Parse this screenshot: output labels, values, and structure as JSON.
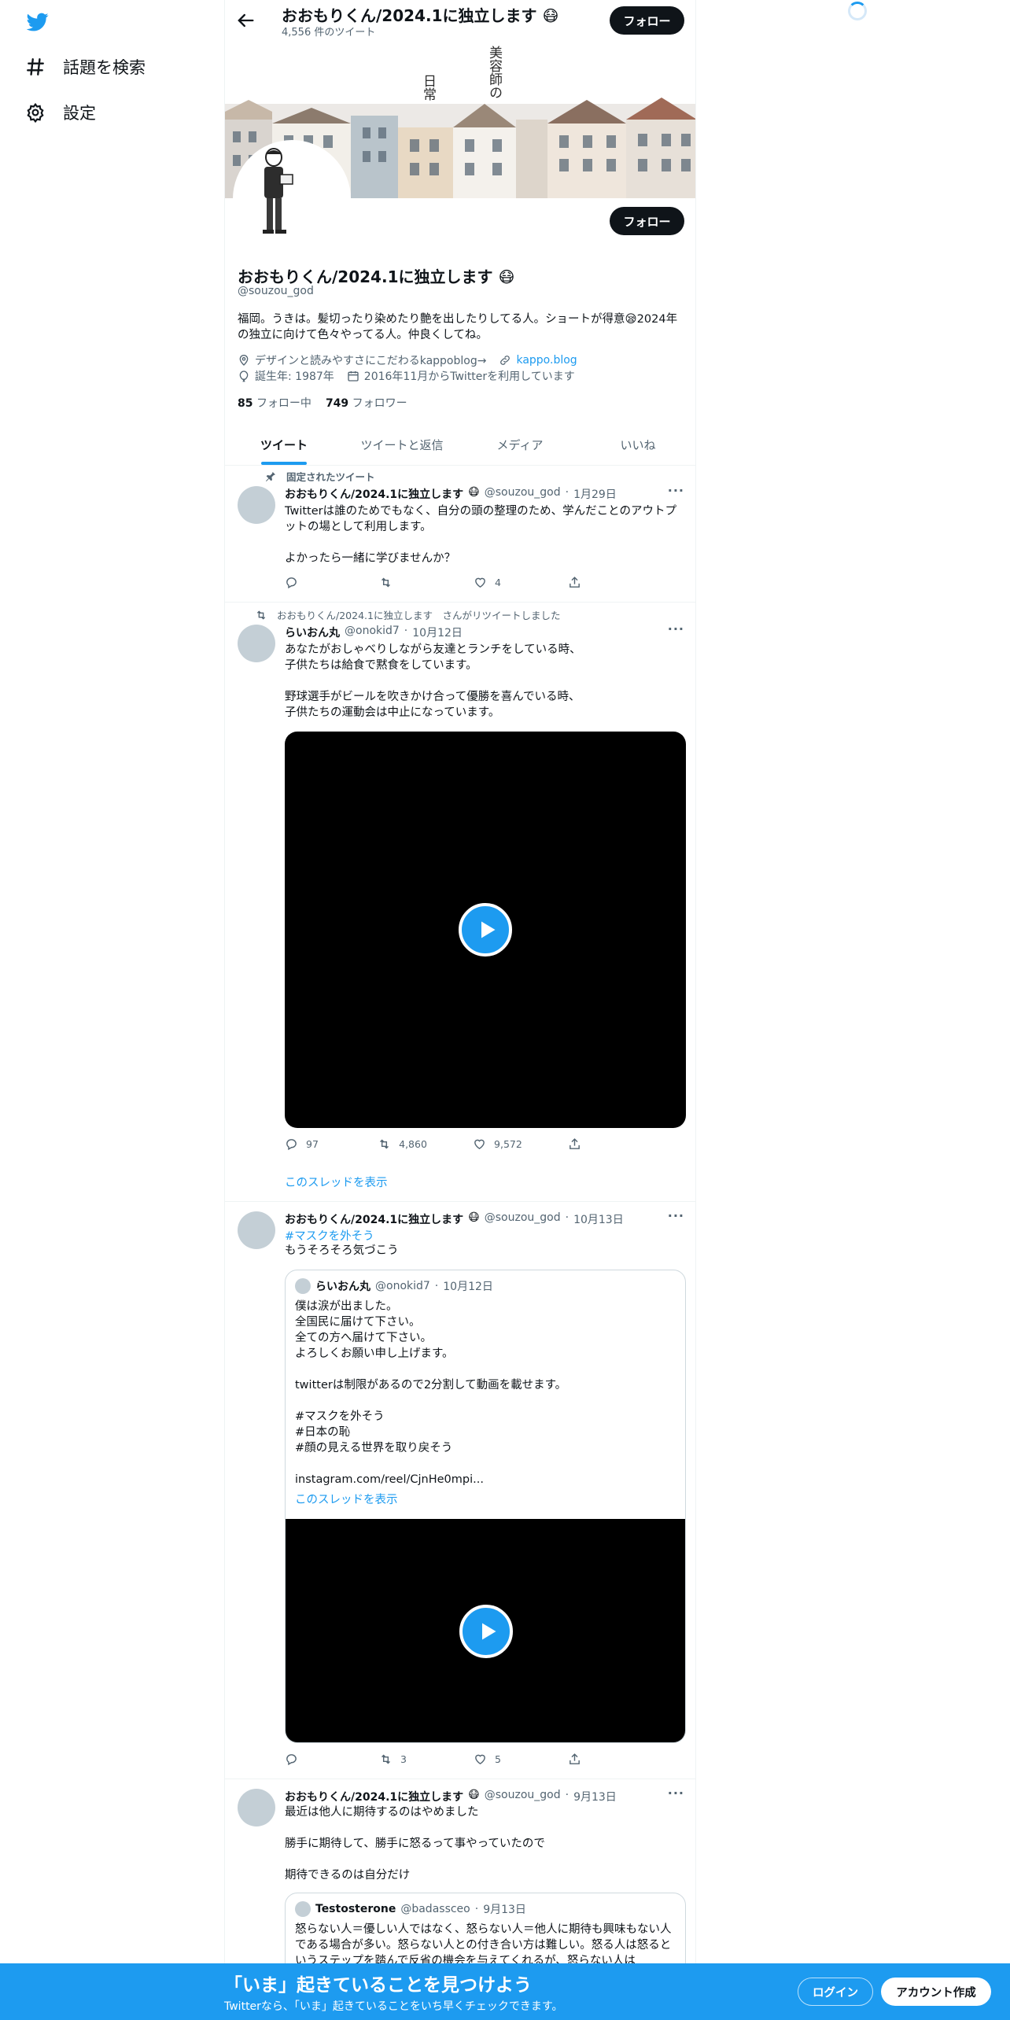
{
  "nav": {
    "explore_label": "話題を検索",
    "settings_label": "設定"
  },
  "header": {
    "title": "おおもりくん/2024.1に独立します",
    "tweet_count": "4,556 件のツイート",
    "follow_label": "フォロー"
  },
  "banner": {
    "text_col1": "美容師の",
    "text_col2": "日常"
  },
  "profile": {
    "name": "おおもりくん/2024.1に独立します",
    "handle": "@souzou_god",
    "bio": "福岡。うきは。髪切ったり染めたり艶を出したりしてる人。ショートが得意😪2024年の独立に向けて色々やってる人。仲良くしてね。",
    "location": "デザインと読みやすさにこだわるkappoblog→",
    "website": "kappo.blog",
    "birth": "誕生年: 1987年",
    "joined": "2016年11月からTwitterを利用しています",
    "following_count": "85",
    "following_label": "フォロー中",
    "followers_count": "749",
    "followers_label": "フォロワー",
    "follow_label": "フォロー"
  },
  "tabs": [
    "ツイート",
    "ツイートと返信",
    "メディア",
    "いいね"
  ],
  "tweets": [
    {
      "pinned_label": "固定されたツイート",
      "name": "おおもりくん/2024.1に独立します",
      "handle": "@souzou_god",
      "date": "1月29日",
      "text": "Twitterは誰のためでもなく、自分の頭の整理のため、学んだことのアウトプットの場として利用します。\n\nよかったら一緒に学びませんか？",
      "replies": "",
      "retweets": "",
      "likes": "4"
    },
    {
      "retweeted_by": "おおもりくん/2024.1に独立します　さんがリツイートしました",
      "name": "らいおん丸",
      "handle": "@onokid7",
      "date": "10月12日",
      "text": "あなたがおしゃべりしながら友達とランチをしている時、\n子供たちは給食で黙食をしています。\n\n野球選手がビールを吹きかけ合って優勝を喜んでいる時、\n子供たちの運動会は中止になっています。",
      "replies": "97",
      "retweets": "4,860",
      "likes": "9,572",
      "thread_link": "このスレッドを表示"
    },
    {
      "name": "おおもりくん/2024.1に独立します",
      "handle": "@souzou_god",
      "date": "10月13日",
      "hashtag": "#マスクを外そう",
      "text": "もうそろそろ気づこう",
      "quote": {
        "name": "らいおん丸",
        "handle": "@onokid7",
        "date": "10月12日",
        "text": "僕は涙が出ました。\n全国民に届けて下さい。\n全ての方へ届けて下さい。\nよろしくお願い申し上げます。\n\ntwitterは制限があるので2分割して動画を載せます。\n\n#マスクを外そう\n#日本の恥\n#顔の見える世界を取り戻そう\n\ninstagram.com/reel/CjnHe0mpi...",
        "thread_link": "このスレッドを表示"
      },
      "replies": "",
      "retweets": "3",
      "likes": "5"
    },
    {
      "name": "おおもりくん/2024.1に独立します",
      "handle": "@souzou_god",
      "date": "9月13日",
      "text": "最近は他人に期待するのはやめました\n\n勝手に期待して、勝手に怒るって事やっていたので\n\n期待できるのは自分だけ",
      "quote": {
        "name": "Testosterone",
        "handle": "@badassceo",
        "date": "9月13日",
        "text": "怒らない人＝優しい人ではなく、怒らない人＝他人に期待も興味もない人である場合が多い。怒らない人との付き合い方は難しい。怒る人は怒るというステップを踏んで反省の機会を与えてくれるが、怒らない人は"
      }
    }
  ],
  "bottom_bar": {
    "title": "「いま」起きていることを見つけよう",
    "subtitle": "Twitterなら、「いま」起きていることをいち早くチェックできます。",
    "login_label": "ログイン",
    "signup_label": "アカウント作成"
  },
  "colors": {
    "accent": "#1d9bf0",
    "text": "#0f1419",
    "muted": "#536471"
  }
}
